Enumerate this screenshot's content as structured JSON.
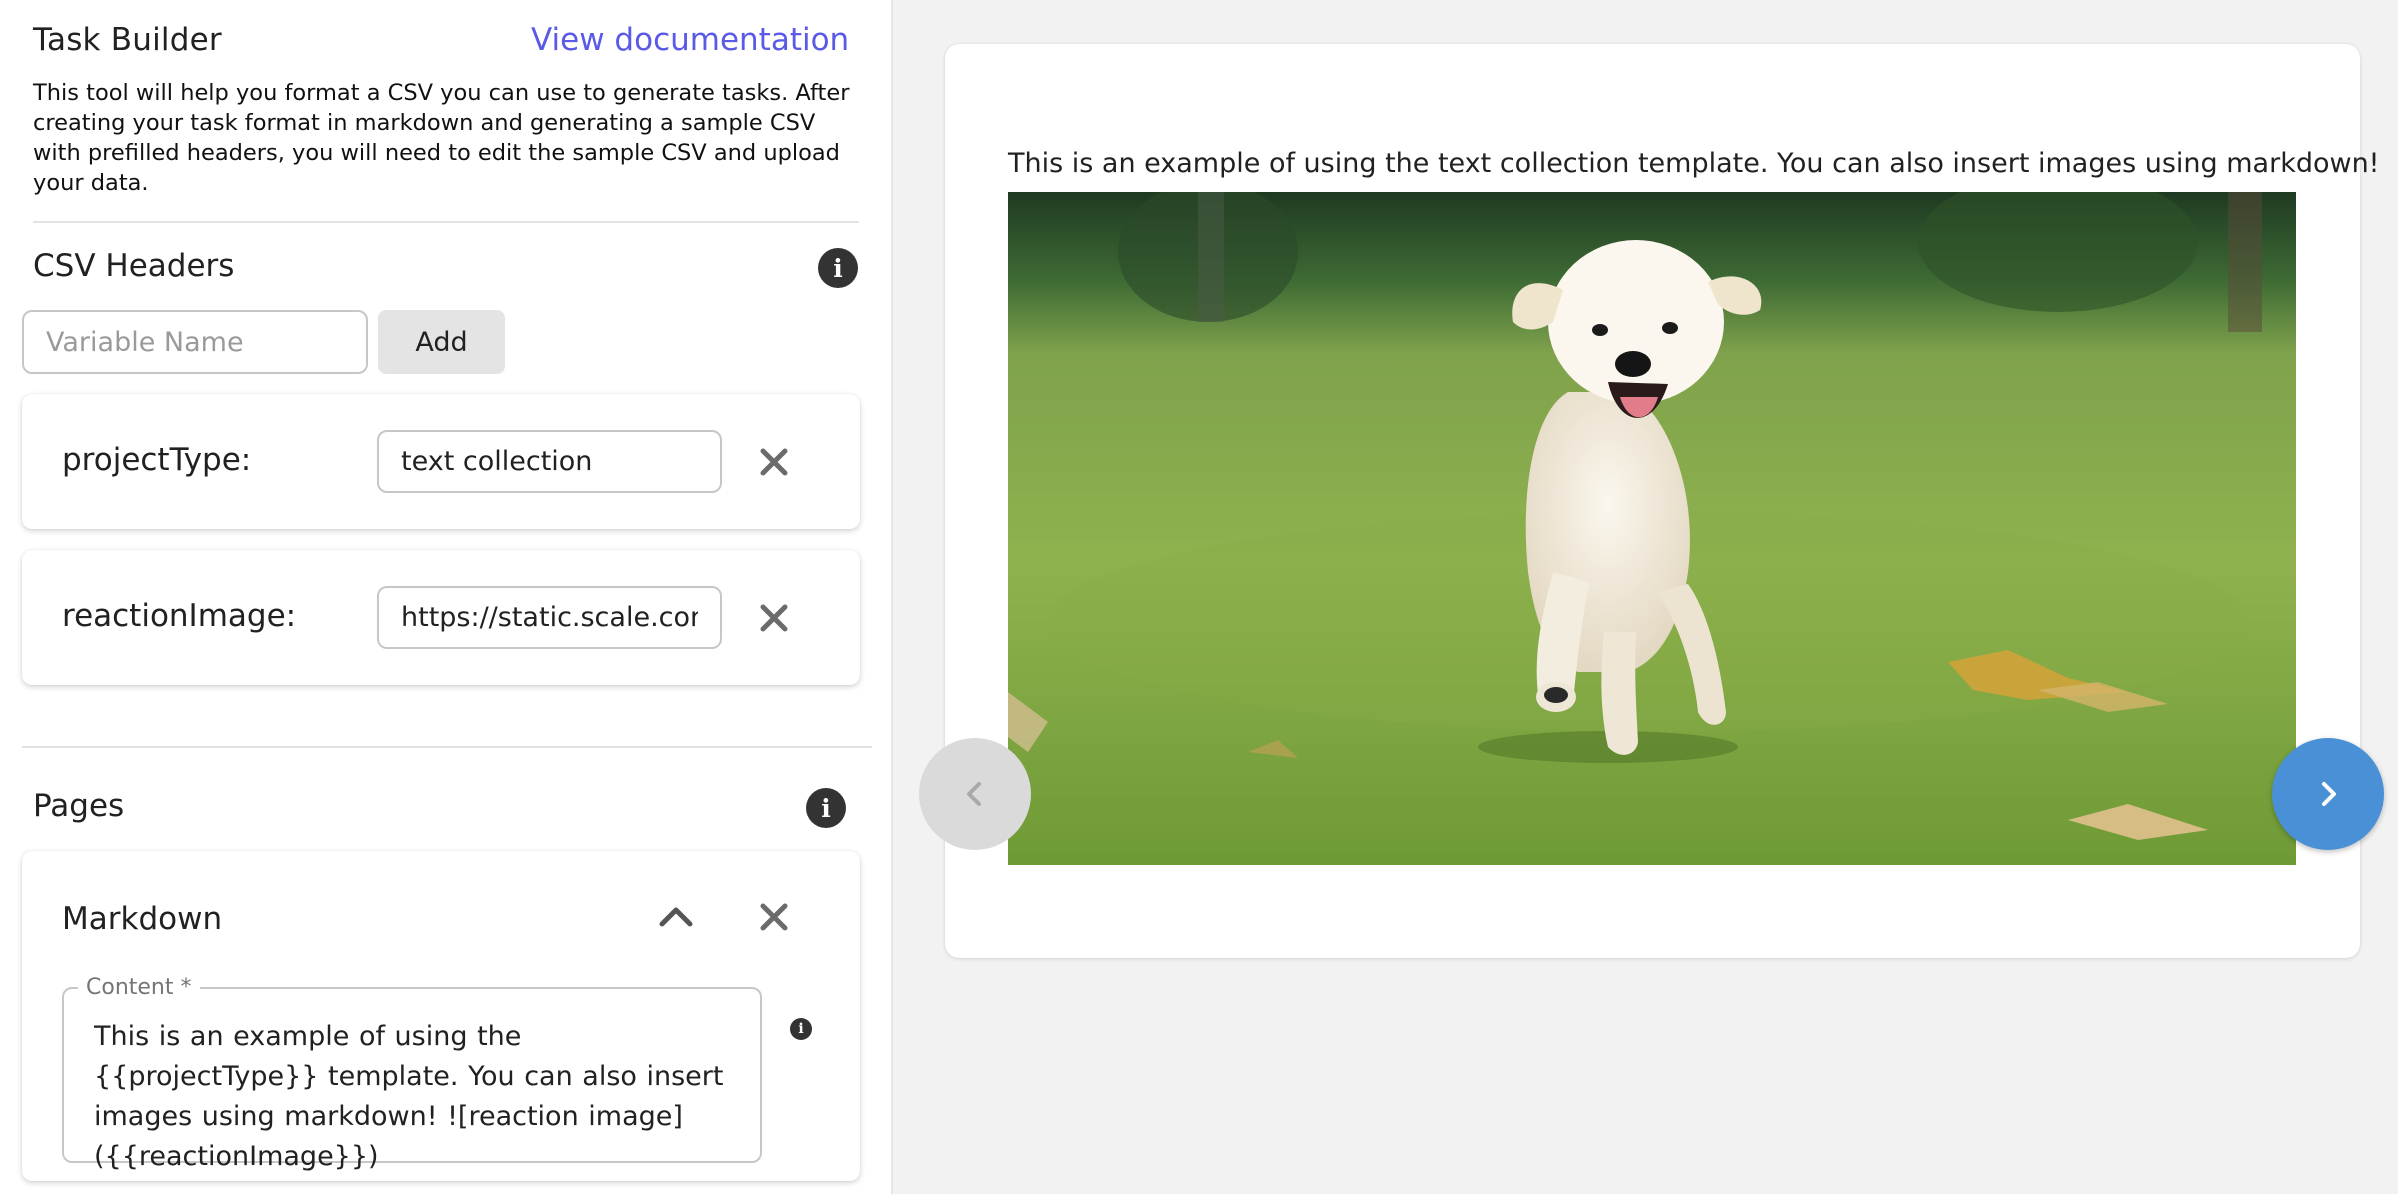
{
  "header": {
    "title": "Task Builder",
    "docs_link": "View documentation",
    "description": "This tool will help you format a CSV you can use to generate tasks. After creating your task format in markdown and generating a sample CSV with prefilled headers, you will need to edit the sample CSV and upload your data."
  },
  "csv_headers": {
    "title": "CSV Headers",
    "info_icon": "info-icon",
    "variable_placeholder": "Variable Name",
    "add_label": "Add",
    "items": [
      {
        "label": "projectType:",
        "value": "text collection",
        "remove_icon": "close-icon"
      },
      {
        "label": "reactionImage:",
        "value": "https://static.scale.com/",
        "remove_icon": "close-icon"
      }
    ]
  },
  "pages": {
    "title": "Pages",
    "info_icon": "info-icon",
    "block": {
      "title": "Markdown",
      "collapse_icon": "chevron-up-icon",
      "remove_icon": "close-icon",
      "content_label": "Content *",
      "content_value": "This is an example of using the  {{projectType}} template. You can also insert images using markdown! ![reaction image]({{reactionImage}})"
    }
  },
  "preview": {
    "text": "This is an example of using the text collection template. You can also insert images using markdown!",
    "image_alt": "reaction image",
    "prev_icon": "chevron-left-icon",
    "next_icon": "chevron-right-icon"
  },
  "colors": {
    "link": "#5a5ae6",
    "next_button": "#4a90d6",
    "prev_button": "#dadada",
    "info_icon": "#333333",
    "close_icon": "#6b6b6b"
  }
}
